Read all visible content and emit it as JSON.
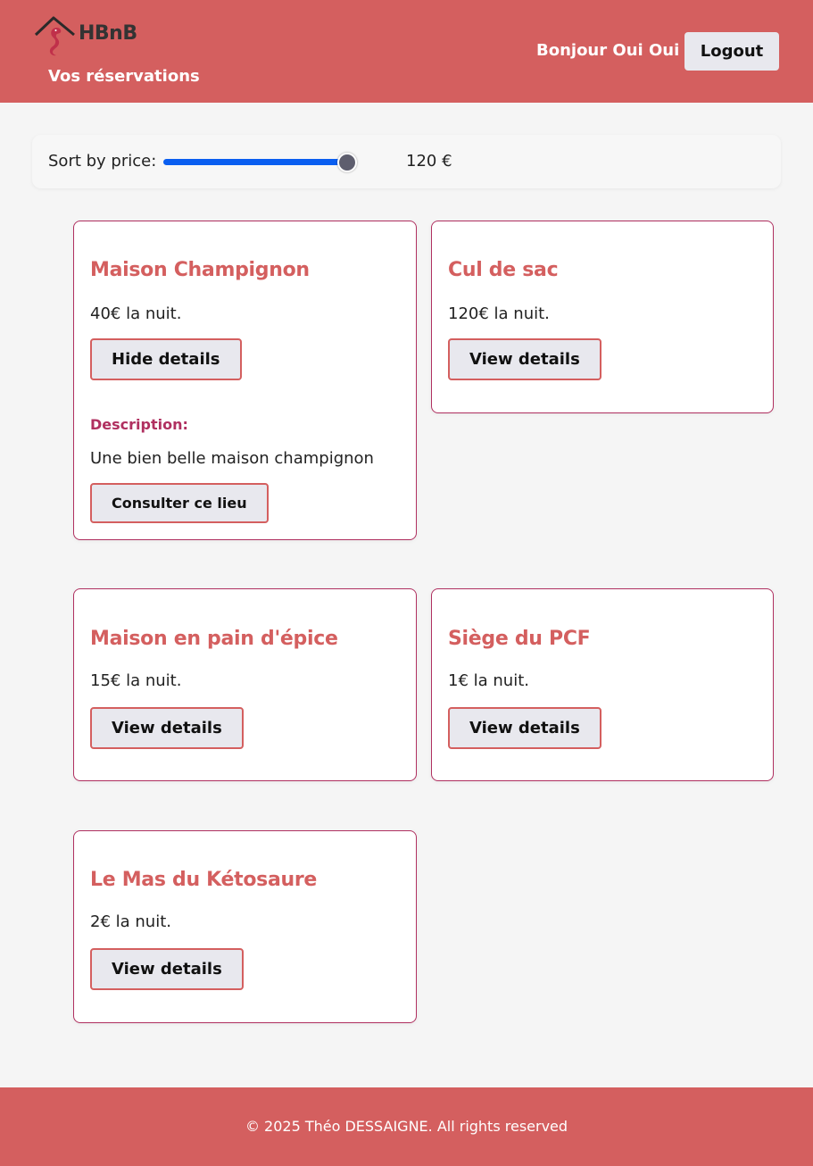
{
  "header": {
    "logo_text": "HBnB",
    "reservations_link": "Vos réservations",
    "greeting": "Bonjour Oui Oui",
    "logout_label": "Logout"
  },
  "filter": {
    "label": "Sort by price:",
    "value": "120 €",
    "slider_level": 1.0
  },
  "places": [
    {
      "title": "Maison Champignon",
      "price": "40€ la nuit.",
      "button": "Hide details",
      "expanded": true,
      "description_label": "Description:",
      "description": "Une bien belle maison champignon",
      "consult_button": "Consulter ce lieu"
    },
    {
      "title": "Cul de sac",
      "price": "120€ la nuit.",
      "button": "View details"
    },
    {
      "title": "Maison en pain d'épice",
      "price": "15€ la nuit.",
      "button": "View details"
    },
    {
      "title": "Siège du PCF",
      "price": "1€ la nuit.",
      "button": "View details"
    },
    {
      "title": "Le Mas du Kétosaure",
      "price": "2€ la nuit.",
      "button": "View details"
    }
  ],
  "footer": {
    "text": "© 2025 Théo DESSAIGNE. All rights reserved"
  },
  "colors": {
    "header_bg": "#d45f5f",
    "accent": "#d45f5f",
    "card_border": "#b03060",
    "slider": "#0a5ef0",
    "button_bg": "#e8e8ee"
  }
}
